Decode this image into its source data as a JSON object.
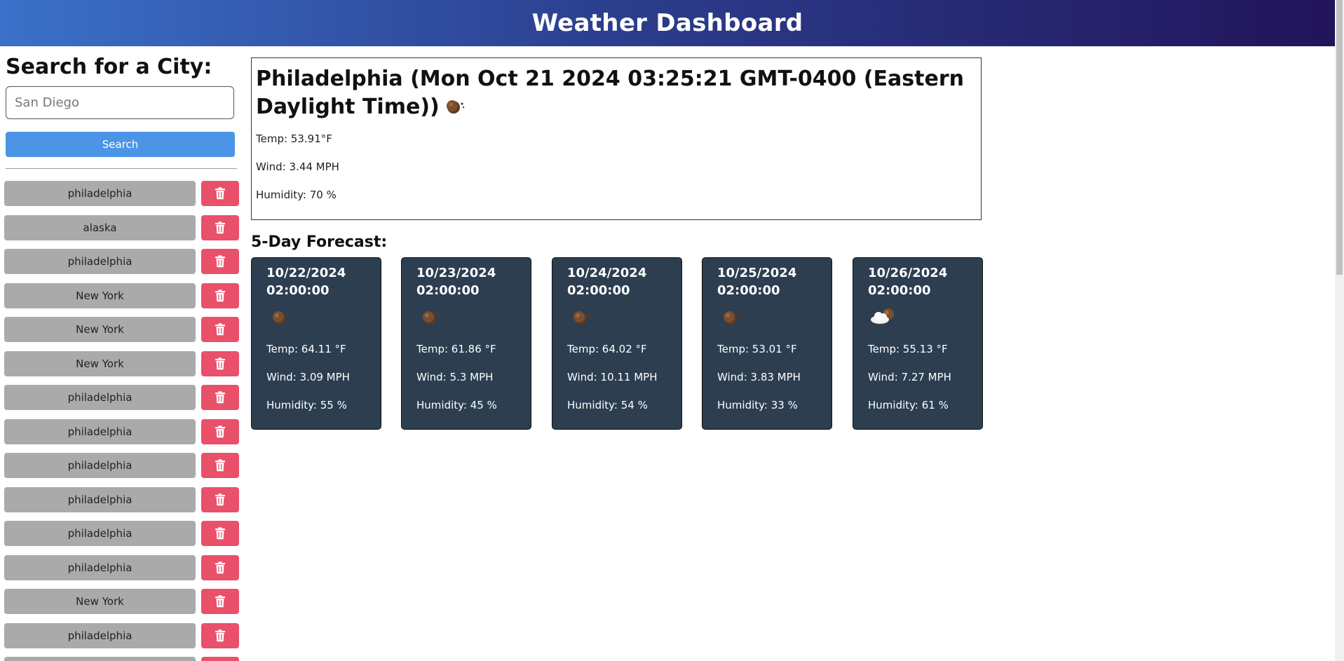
{
  "header": {
    "title": "Weather Dashboard"
  },
  "sidebar": {
    "search_title": "Search for a City:",
    "search_placeholder": "San Diego",
    "search_value": "",
    "search_button": "Search",
    "history": [
      "philadelphia",
      "alaska",
      "philadelphia",
      "New York",
      "New York",
      "New York",
      "philadelphia",
      "philadelphia",
      "philadelphia",
      "philadelphia",
      "philadelphia",
      "philadelphia",
      "New York",
      "philadelphia",
      ""
    ],
    "delete_icon": "trash-icon"
  },
  "current": {
    "title": "Philadelphia (Mon Oct 21 2024 03:25:21 GMT-0400 (Eastern Daylight Time))",
    "icon": "moon-clear-icon",
    "temp": "Temp: 53.91°F",
    "wind": "Wind: 3.44 MPH",
    "humidity": "Humidity: 70 %"
  },
  "forecast": {
    "title": "5-Day Forecast:",
    "days": [
      {
        "date": "10/22/2024 02:00:00",
        "icon": "moon-clear-icon",
        "temp": "Temp: 64.11 °F",
        "wind": "Wind: 3.09 MPH",
        "humidity": "Humidity: 55 %"
      },
      {
        "date": "10/23/2024 02:00:00",
        "icon": "moon-clear-icon",
        "temp": "Temp: 61.86 °F",
        "wind": "Wind: 5.3 MPH",
        "humidity": "Humidity: 45 %"
      },
      {
        "date": "10/24/2024 02:00:00",
        "icon": "moon-clear-icon",
        "temp": "Temp: 64.02 °F",
        "wind": "Wind: 10.11 MPH",
        "humidity": "Humidity: 54 %"
      },
      {
        "date": "10/25/2024 02:00:00",
        "icon": "moon-clear-icon",
        "temp": "Temp: 53.01 °F",
        "wind": "Wind: 3.83 MPH",
        "humidity": "Humidity: 33 %"
      },
      {
        "date": "10/26/2024 02:00:00",
        "icon": "cloud-moon-icon",
        "temp": "Temp: 55.13 °F",
        "wind": "Wind: 7.27 MPH",
        "humidity": "Humidity: 61 %"
      }
    ]
  },
  "colors": {
    "header_gradient": [
      "#3b71c9",
      "#22145a"
    ],
    "search_button": "#4c95e6",
    "city_button": "#aaaaaa",
    "delete_button": "#e9506a",
    "forecast_card": "#2c3e50"
  }
}
